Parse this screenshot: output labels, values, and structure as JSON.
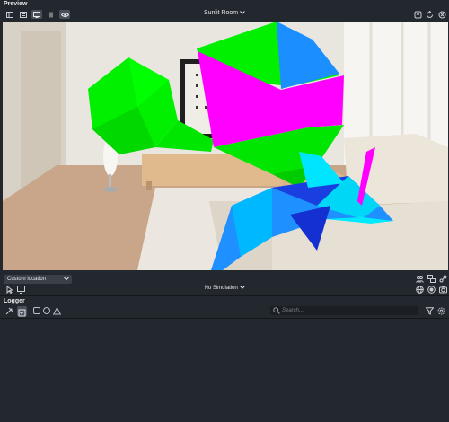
{
  "preview": {
    "title": "Preview",
    "room_selector": "Sunlit Room",
    "viewport_label": "3D preview of the Sunlit Room scene"
  },
  "location": {
    "selected": "Custom location"
  },
  "simulation": {
    "label": "No Simulation"
  },
  "logger": {
    "title": "Logger",
    "search_placeholder": "Search..."
  },
  "icons": {
    "toolbar": [
      "sidebar-toggle-icon",
      "list-icon",
      "monitor-icon",
      "pause-icon",
      "eye-icon"
    ],
    "preview_right": [
      "refresh-icon",
      "rotate-icon",
      "close-icon"
    ],
    "location_right": [
      "people-icon",
      "screens-icon",
      "share-icon",
      "globe-icon",
      "record-icon",
      "camera-icon"
    ],
    "logger_left": [
      "clear-log-icon",
      "wrap-icon",
      "info-filter-icon",
      "warning-filter-icon",
      "error-filter-icon"
    ],
    "logger_right": [
      "filter-icon",
      "settings-icon"
    ]
  },
  "colors": {
    "accent_green": "#00ff00",
    "accent_magenta": "#ff00ff",
    "accent_blue": "#1e88ff",
    "accent_cyan": "#00e5ff",
    "panel_bg": "#23272e"
  }
}
